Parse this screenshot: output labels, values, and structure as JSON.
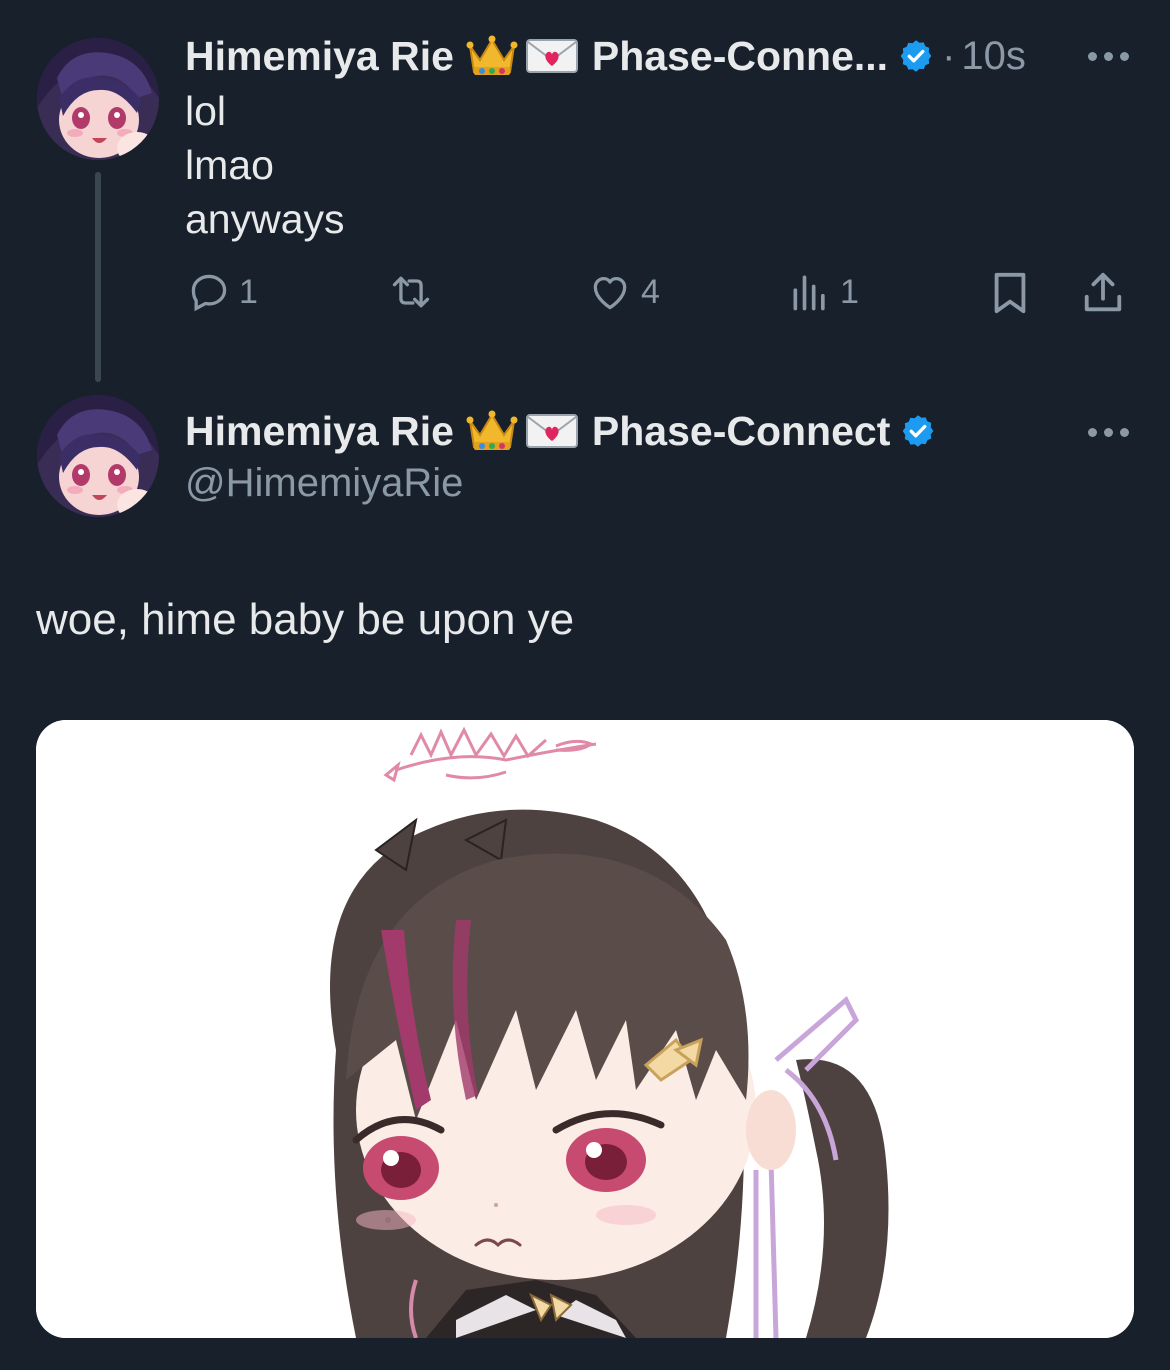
{
  "tweet1": {
    "display_name": "Himemiya Rie",
    "emojis": [
      "crown-emoji",
      "love-letter-emoji"
    ],
    "affiliation": "Phase-Conne...",
    "timestamp_sep": "·",
    "timestamp": "10s",
    "lines": [
      "lol",
      "lmao",
      "anyways"
    ],
    "actions": {
      "reply_count": "1",
      "repost_count": "",
      "like_count": "4",
      "views_count": "1"
    }
  },
  "tweet2": {
    "display_name": "Himemiya Rie",
    "emojis": [
      "crown-emoji",
      "love-letter-emoji"
    ],
    "affiliation": "Phase-Connect",
    "handle": "@HimemiyaRie",
    "text": "woe, hime baby be upon ye",
    "media": "chibi-anime-girl-image"
  },
  "colors": {
    "background": "#17202b",
    "text": "#e7e9ea",
    "muted": "#8b98a5",
    "verified": "#1d9bf0",
    "thread_line": "#3a4652"
  }
}
